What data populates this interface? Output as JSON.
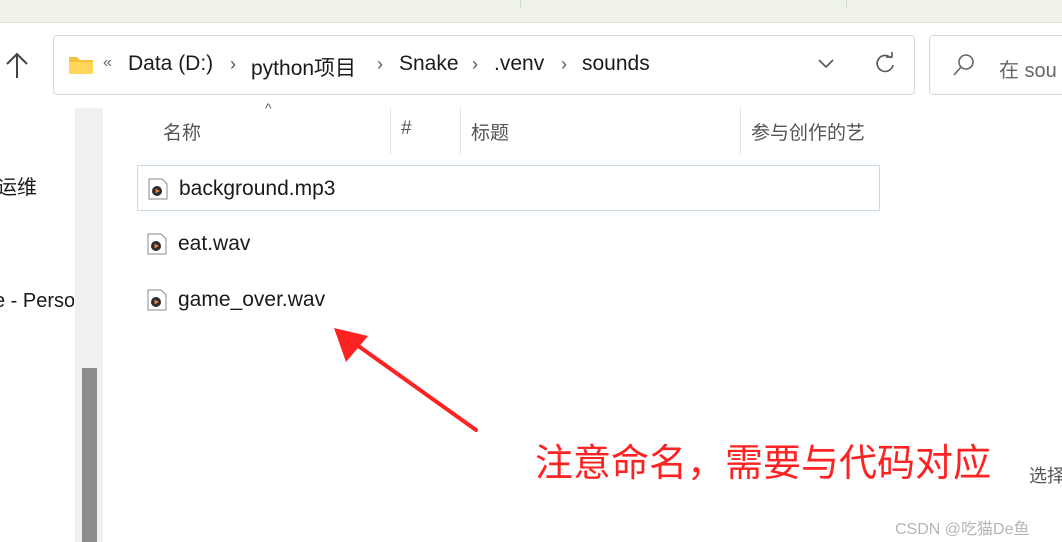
{
  "address_bar": {
    "overflow": "«",
    "crumbs": [
      "Data (D:)",
      "python项目",
      "Snake",
      ".venv",
      "sounds"
    ]
  },
  "search": {
    "placeholder": "在 sou"
  },
  "nav_pane": {
    "item_a": "运维",
    "item_b": "e - Perso"
  },
  "columns": {
    "name": "名称",
    "number": "#",
    "title": "标题",
    "contributing_artists": "参与创作的艺"
  },
  "files": [
    {
      "name": "background.mp3",
      "selected": true
    },
    {
      "name": "eat.wav",
      "selected": false
    },
    {
      "name": "game_over.wav",
      "selected": false
    }
  ],
  "annotation": {
    "text": "注意命名，需要与代码对应",
    "color": "#ff2222"
  },
  "details_pane_label": "选择",
  "watermark": "CSDN @吃猫De鱼",
  "icons": [
    "up-arrow-icon",
    "folder-icon",
    "chevron-down-icon",
    "refresh-icon",
    "search-icon",
    "audio-file-icon"
  ]
}
